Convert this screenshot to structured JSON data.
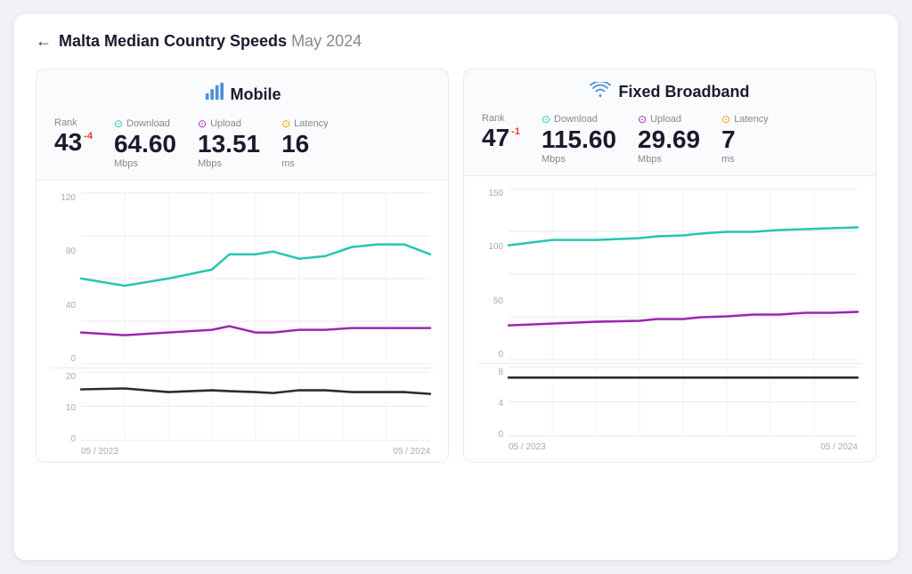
{
  "page": {
    "title": "Malta Median Country Speeds",
    "title_date": "May 2024",
    "back_label": "←"
  },
  "mobile": {
    "panel_title": "Mobile",
    "rank_label": "Rank",
    "rank_value": "43",
    "rank_delta": "-4",
    "download_label": "Download",
    "download_value": "64.60",
    "download_unit": "Mbps",
    "upload_label": "Upload",
    "upload_value": "13.51",
    "upload_unit": "Mbps",
    "latency_label": "Latency",
    "latency_value": "16",
    "latency_unit": "ms",
    "speed_y_labels": [
      "120",
      "80",
      "40",
      "0"
    ],
    "latency_y_labels": [
      "20",
      "10",
      "0"
    ],
    "x_labels": [
      "05 / 2023",
      "05 / 2024"
    ]
  },
  "broadband": {
    "panel_title": "Fixed Broadband",
    "rank_label": "Rank",
    "rank_value": "47",
    "rank_delta": "-1",
    "download_label": "Download",
    "download_value": "115.60",
    "download_unit": "Mbps",
    "upload_label": "Upload",
    "upload_value": "29.69",
    "upload_unit": "Mbps",
    "latency_label": "Latency",
    "latency_value": "7",
    "latency_unit": "ms",
    "speed_y_labels": [
      "150",
      "100",
      "50",
      "0"
    ],
    "latency_y_labels": [
      "8",
      "4",
      "0"
    ],
    "x_labels": [
      "05 / 2023",
      "05 / 2024"
    ]
  },
  "icons": {
    "back": "←",
    "mobile": "📶",
    "wifi": "WiFi",
    "download": "↓",
    "upload": "↑",
    "latency": "$"
  }
}
